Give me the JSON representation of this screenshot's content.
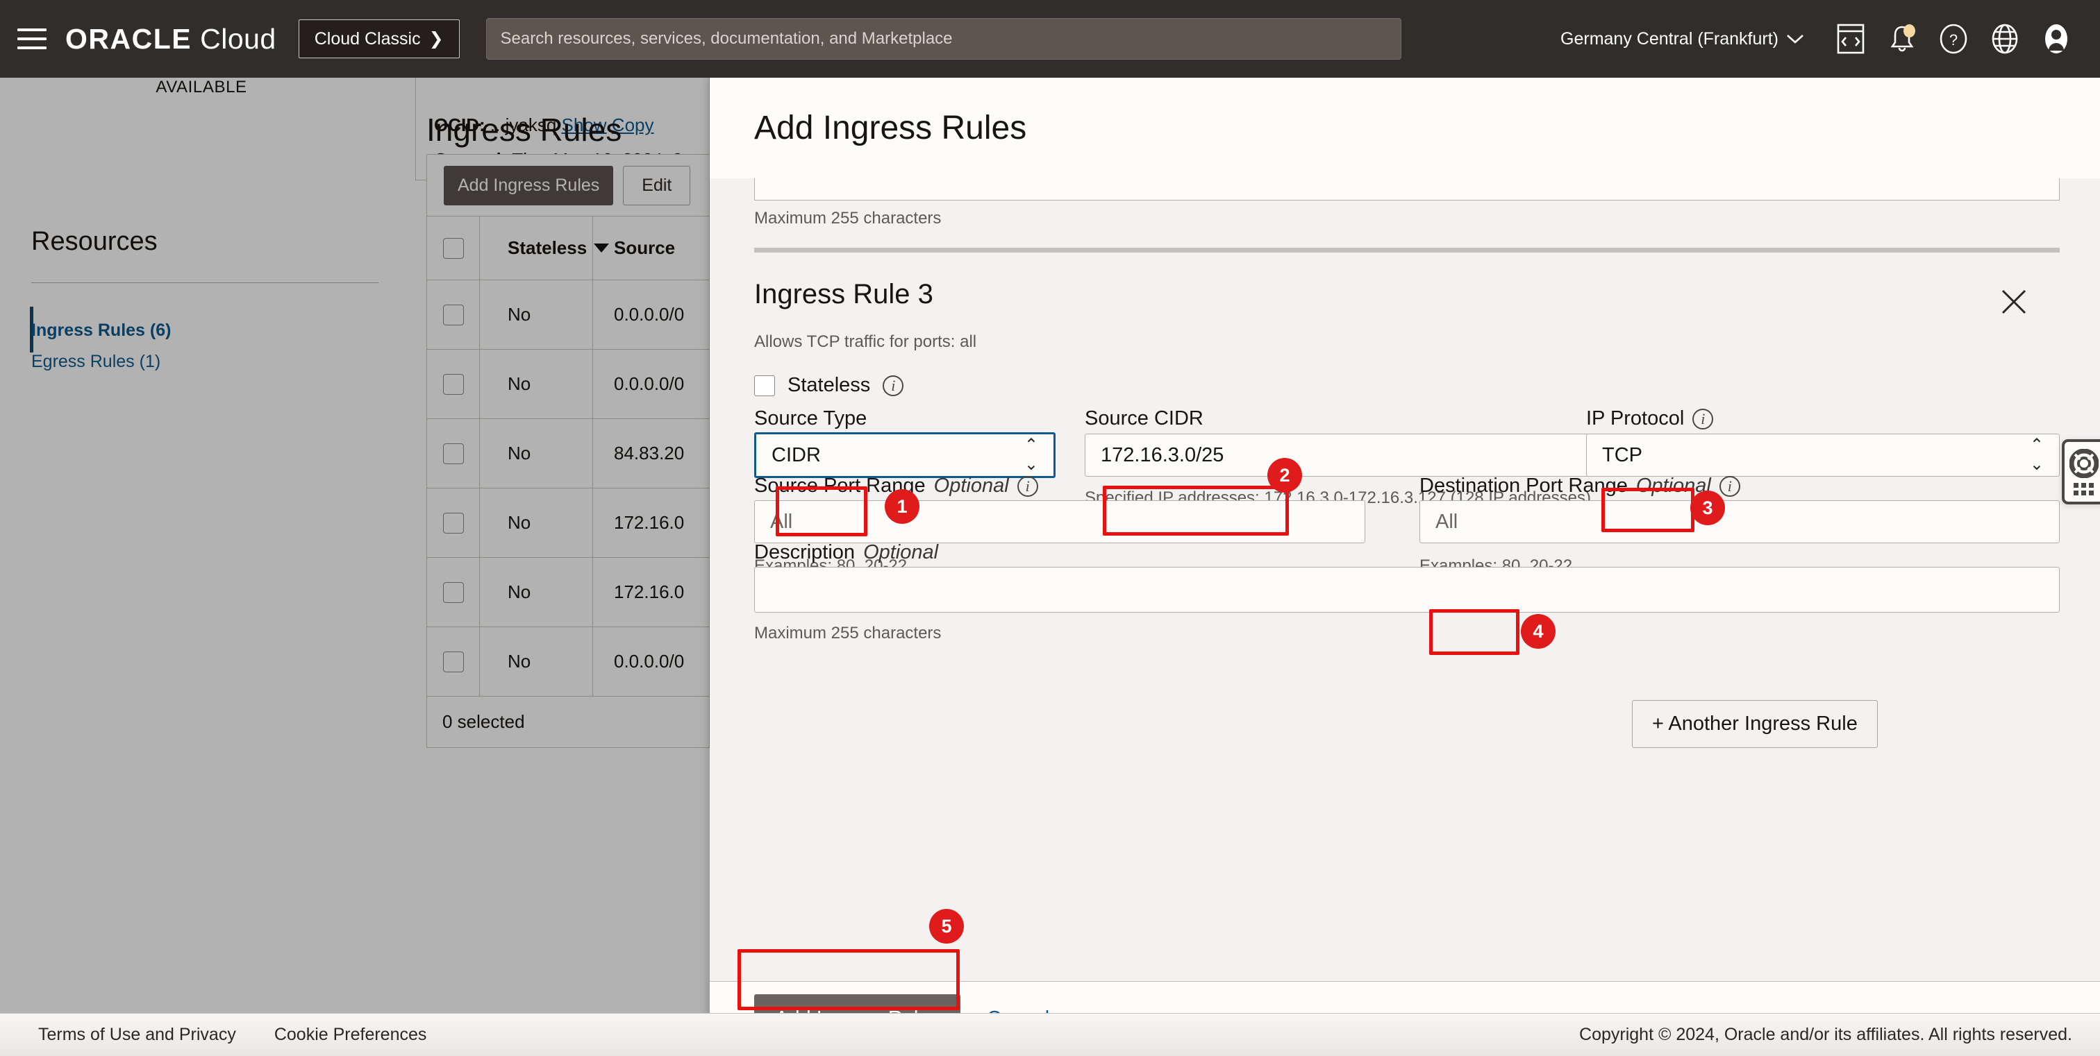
{
  "topnav": {
    "menu_icon": "hamburger-menu-icon",
    "brand_oracle": "ORACLE",
    "brand_cloud": "Cloud",
    "cloud_classic_label": "Cloud Classic",
    "cloud_classic_chevron": "❯",
    "search_placeholder": "Search resources, services, documentation, and Marketplace",
    "search_value": "",
    "region": "Germany Central (Frankfurt)",
    "region_chevron": "⌄",
    "icons": [
      "cloud-shell-icon",
      "notifications-bell-icon",
      "help-question-icon",
      "language-globe-icon",
      "user-avatar-icon"
    ]
  },
  "background": {
    "status": "AVAILABLE",
    "ocid_label": "OCID:",
    "ocid_value": "...jyaksq",
    "ocid_show": "Show",
    "ocid_copy": "Copy",
    "created_label": "Created:",
    "created_value": "Thu, May 16, 2024, 0",
    "resources_title": "Resources",
    "resource_items": [
      {
        "label": "Ingress Rules (6)",
        "active": true
      },
      {
        "label": "Egress Rules (1)",
        "active": false
      }
    ],
    "table_heading": "Ingress Rules",
    "toolbar": {
      "add_label": "Add Ingress Rules",
      "edit_label": "Edit"
    },
    "columns": [
      "Stateless",
      "Source"
    ],
    "rows": [
      {
        "stateless": "No",
        "source": "0.0.0.0/0"
      },
      {
        "stateless": "No",
        "source": "0.0.0.0/0"
      },
      {
        "stateless": "No",
        "source": "84.83.20"
      },
      {
        "stateless": "No",
        "source": "172.16.0"
      },
      {
        "stateless": "No",
        "source": "172.16.0"
      },
      {
        "stateless": "No",
        "source": "0.0.0.0/0"
      }
    ],
    "footer_selected": "0 selected"
  },
  "panel": {
    "title": "Add Ingress Rules",
    "top_field_hint": "Maximum 255 characters",
    "rule": {
      "heading": "Ingress Rule 3",
      "subtitle": "Allows TCP traffic for ports: all",
      "close_icon": "close-x-icon",
      "stateless_label": "Stateless",
      "source_type": {
        "label": "Source Type",
        "value": "CIDR"
      },
      "source_cidr": {
        "label": "Source CIDR",
        "value": "172.16.3.0/25",
        "hint": "Specified IP addresses: 172.16.3.0-172.16.3.127 (128 IP addresses)"
      },
      "ip_protocol": {
        "label": "IP Protocol",
        "value": "TCP"
      },
      "source_port_range": {
        "label": "Source Port Range",
        "optional": "Optional",
        "placeholder": "All",
        "value": "",
        "hint": "Examples: 80, 20-22"
      },
      "destination_port_range": {
        "label": "Destination Port Range",
        "optional": "Optional",
        "placeholder": "All",
        "value": "",
        "hint": "Examples: 80, 20-22"
      },
      "description": {
        "label": "Description",
        "optional": "Optional",
        "value": "",
        "hint": "Maximum 255 characters"
      }
    },
    "another_rule_label": "+ Another Ingress Rule",
    "submit_label": "Add Ingress Rules",
    "cancel_label": "Cancel",
    "help_widget_icon": "lifebuoy-support-icon"
  },
  "annotations": [
    {
      "n": "1",
      "target": "source-type-field"
    },
    {
      "n": "2",
      "target": "source-cidr-field"
    },
    {
      "n": "3",
      "target": "ip-protocol-field"
    },
    {
      "n": "4",
      "target": "destination-port-range-field"
    },
    {
      "n": "5",
      "target": "add-ingress-rules-submit-button"
    }
  ],
  "footer": {
    "terms": "Terms of Use and Privacy",
    "cookies": "Cookie Preferences",
    "copyright": "Copyright © 2024, Oracle and/or its affiliates. All rights reserved."
  },
  "colors": {
    "nav_bg": "#312d2a",
    "accent_link": "#0f5a8f",
    "annotation_red": "#e8110f",
    "primary_button": "#6b635e"
  }
}
